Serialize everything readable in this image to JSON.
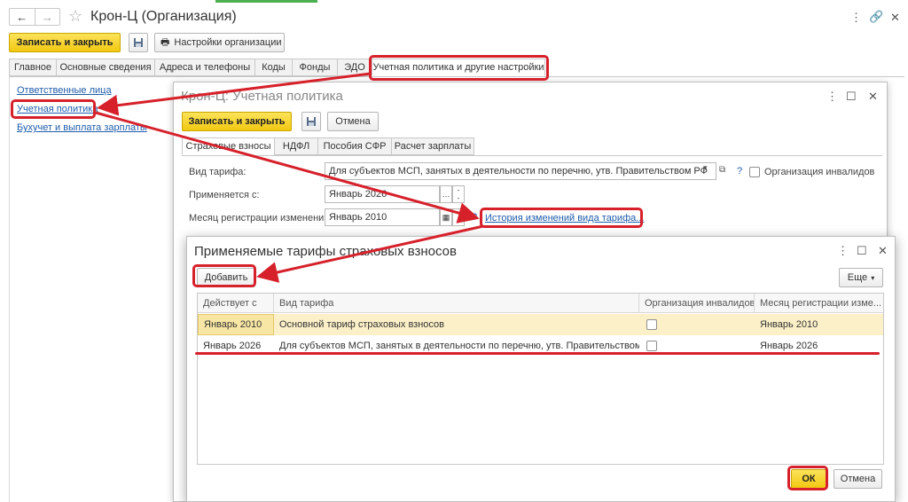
{
  "main": {
    "title": "Крон-Ц (Организация)",
    "save_close": "Записать и закрыть",
    "settings_btn": "Настройки организации",
    "tabs": [
      "Главное",
      "Основные сведения",
      "Адреса и телефоны",
      "Коды",
      "Фонды",
      "ЭДО",
      "Учетная политика и другие настройки"
    ],
    "sidebar": [
      "Ответственные лица",
      "Учетная политика",
      "Бухучет и выплата зарплаты"
    ]
  },
  "policy": {
    "title": "Крон-Ц: Учетная политика",
    "save_close": "Записать и закрыть",
    "cancel": "Отмена",
    "tabs": [
      "Страховые взносы",
      "НДФЛ",
      "Пособия СФР",
      "Расчет зарплаты"
    ],
    "tariff_label": "Вид тарифа:",
    "tariff_value": "Для субъектов МСП, занятых в деятельности по перечню, утв. Правительством РФ",
    "invalid_org": "Организация инвалидов",
    "applied_label": "Применяется с:",
    "applied_value": "Январь 2026",
    "month_label": "Месяц регистрации изменений:",
    "month_value": "Январь 2010",
    "history_link": "История изменений вида тарифа...",
    "help": "?"
  },
  "tariffs": {
    "title": "Применяемые тарифы страховых взносов",
    "add": "Добавить",
    "more": "Еще",
    "columns": [
      "Действует с",
      "Вид тарифа",
      "Организация инвалидов",
      "Месяц регистрации изме..."
    ],
    "rows": [
      {
        "from": "Январь 2010",
        "type": "Основной тариф страховых взносов",
        "invalid": false,
        "month": "Январь 2010"
      },
      {
        "from": "Январь 2026",
        "type": "Для субъектов МСП, занятых в деятельности по перечню, утв. Правительством РФ",
        "invalid": false,
        "month": "Январь 2026"
      }
    ],
    "ok": "ОК",
    "cancel": "Отмена"
  },
  "colors": {
    "accent_yellow": "#f2c811",
    "highlight_red": "#d6212b",
    "link_blue": "#1f5dab",
    "row_selected": "#fbf0c8"
  }
}
